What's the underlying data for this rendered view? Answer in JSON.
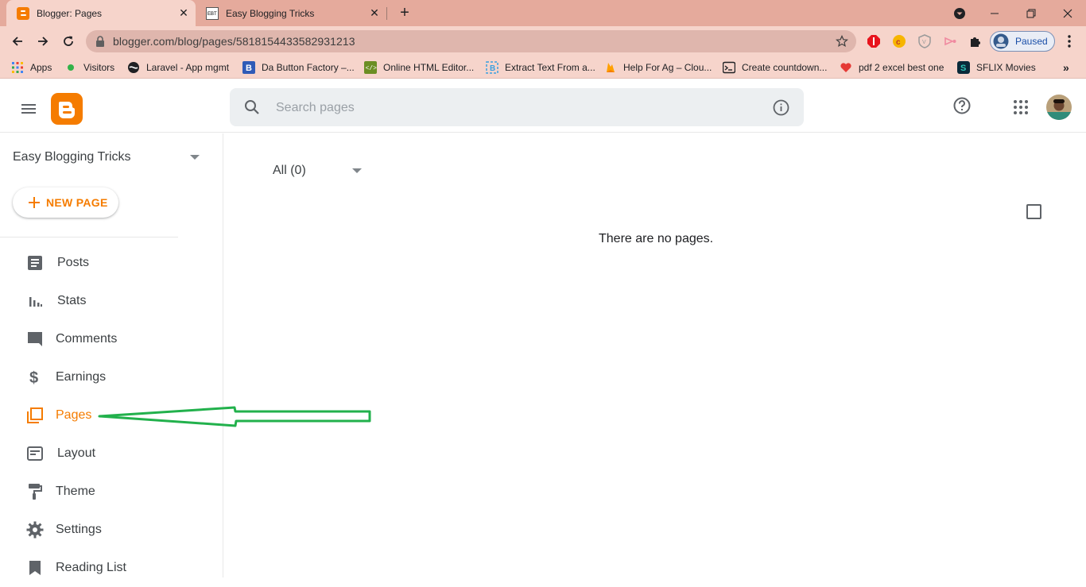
{
  "browser": {
    "tabs": [
      {
        "title": "Blogger: Pages",
        "active": true
      },
      {
        "title": "Easy Blogging Tricks",
        "active": false
      }
    ],
    "url": "blogger.com/blog/pages/5818154433582931213",
    "profile_status": "Paused",
    "bookmarks": [
      {
        "label": "Apps",
        "icon": "apps-grid-icon"
      },
      {
        "label": "Visitors",
        "icon": "green-dot-icon"
      },
      {
        "label": "Laravel - App mgmt",
        "icon": "globe-icon"
      },
      {
        "label": "Da Button Factory –...",
        "icon": "button-factory-icon"
      },
      {
        "label": "Online HTML Editor...",
        "icon": "html-editor-icon"
      },
      {
        "label": "Extract Text From a...",
        "icon": "extract-text-icon"
      },
      {
        "label": "Help For Ag – Clou...",
        "icon": "firebase-icon"
      },
      {
        "label": "Create countdown...",
        "icon": "terminal-icon"
      },
      {
        "label": "pdf 2 excel best one",
        "icon": "heart-icon"
      },
      {
        "label": "SFLIX Movies",
        "icon": "sflix-icon"
      }
    ]
  },
  "header": {
    "search_placeholder": "Search pages"
  },
  "sidebar": {
    "blog_name": "Easy Blogging Tricks",
    "new_page_label": "NEW PAGE",
    "items": [
      {
        "label": "Posts",
        "icon": "posts-icon"
      },
      {
        "label": "Stats",
        "icon": "stats-icon"
      },
      {
        "label": "Comments",
        "icon": "comments-icon"
      },
      {
        "label": "Earnings",
        "icon": "dollar-icon"
      },
      {
        "label": "Pages",
        "icon": "pages-icon",
        "active": true
      },
      {
        "label": "Layout",
        "icon": "layout-icon"
      },
      {
        "label": "Theme",
        "icon": "paint-roller-icon"
      },
      {
        "label": "Settings",
        "icon": "gear-icon"
      },
      {
        "label": "Reading List",
        "icon": "bookmark-icon"
      }
    ]
  },
  "main": {
    "filter_label": "All (0)",
    "empty_message": "There are no pages."
  },
  "colors": {
    "accent": "#f57c00",
    "tabstrip": "#e5aa9c",
    "toolbar": "#f6d4cb",
    "annotation_arrow": "#22b14c"
  }
}
